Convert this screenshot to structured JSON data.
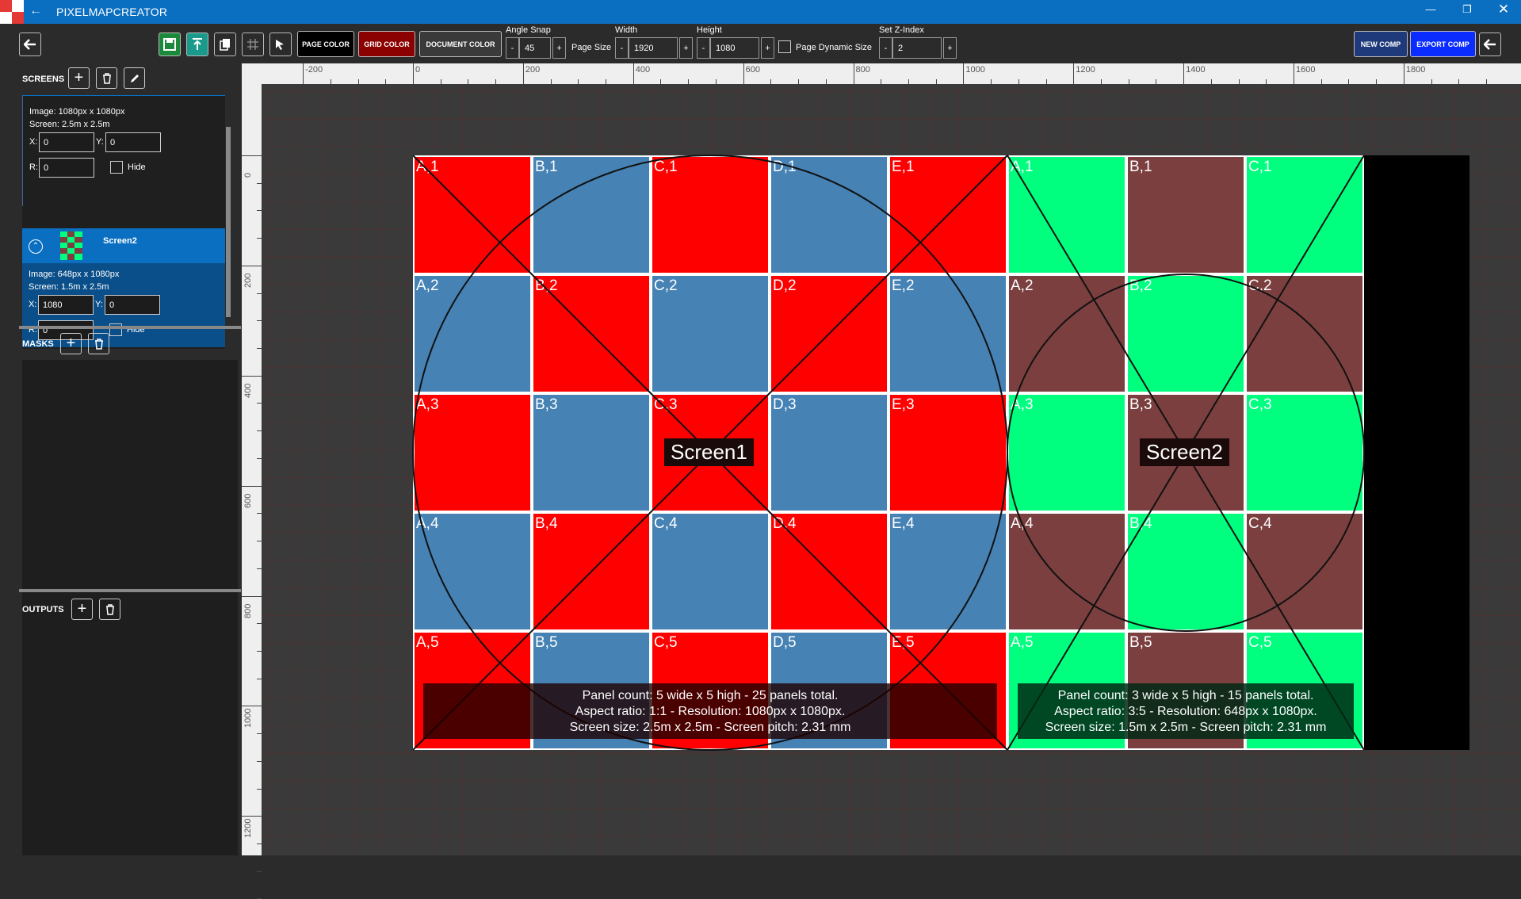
{
  "app": {
    "title": "PIXELMAPCREATOR"
  },
  "toolbar": {
    "page_color": "PAGE COLOR",
    "grid_color": "GRID COLOR",
    "document_color": "DOCUMENT COLOR",
    "angle_snap_label": "Angle Snap",
    "angle_snap": "45",
    "page_size_label": "Page Size",
    "width_label": "Width",
    "width": "1920",
    "height_label": "Height",
    "height": "1080",
    "page_dynamic_label": "Page Dynamic Size",
    "z_index_label": "Set Z-Index",
    "z_index": "2",
    "new_comp": "NEW COMP",
    "export_comp": "EXPORT COMP",
    "minus": "-",
    "plus": "+"
  },
  "sidebar": {
    "screens_title": "SCREENS",
    "masks_title": "MASKS",
    "outputs_title": "OUTPUTS",
    "screens": [
      {
        "name": "",
        "image": "Image: 1080px x 1080px",
        "screen": "Screen: 2.5m x 2.5m",
        "x": "0",
        "y": "0",
        "r": "0",
        "hide": "Hide"
      },
      {
        "name": "Screen2",
        "image": "Image: 648px x 1080px",
        "screen": "Screen: 1.5m x 2.5m",
        "x": "1080",
        "y": "0",
        "r": "0",
        "hide": "Hide"
      }
    ],
    "x_label": "X:",
    "y_label": "Y:",
    "r_label": "R:"
  },
  "rulers": {
    "h": [
      "-200",
      "0",
      "200",
      "400",
      "600",
      "800",
      "1000",
      "1200",
      "1400",
      "1600",
      "1800"
    ],
    "v": [
      "0",
      "200",
      "400",
      "600",
      "800",
      "1000",
      "1200"
    ]
  },
  "canvas": {
    "screen1": {
      "label": "Screen1",
      "cols": [
        "A",
        "B",
        "C",
        "D",
        "E"
      ],
      "rows": [
        "1",
        "2",
        "3",
        "4",
        "5"
      ],
      "colors": [
        "#ff0000",
        "#4682b4"
      ],
      "info": [
        "Panel count: 5 wide x 5 high - 25 panels total.",
        "Aspect ratio: 1:1 - Resolution: 1080px x 1080px.",
        "Screen size: 2.5m x 2.5m - Screen pitch: 2.31 mm"
      ]
    },
    "screen2": {
      "label": "Screen2",
      "cols": [
        "A",
        "B",
        "C"
      ],
      "rows": [
        "1",
        "2",
        "3",
        "4",
        "5"
      ],
      "colors": [
        "#00ff7f",
        "#7b3f3f"
      ],
      "info": [
        "Panel count: 3 wide x 5 high - 15 panels total.",
        "Aspect ratio: 3:5 - Resolution: 648px x 1080px.",
        "Screen size: 1.5m x 2.5m - Screen pitch: 2.31 mm"
      ]
    }
  },
  "icons": {
    "back": "arrow-left-icon",
    "save": "save-icon",
    "upload": "upload-icon",
    "copy": "copy-icon",
    "grid": "grid-icon",
    "tool": "cursor-icon",
    "edit": "pencil-icon",
    "delete": "trash-icon",
    "add": "plus-icon"
  }
}
